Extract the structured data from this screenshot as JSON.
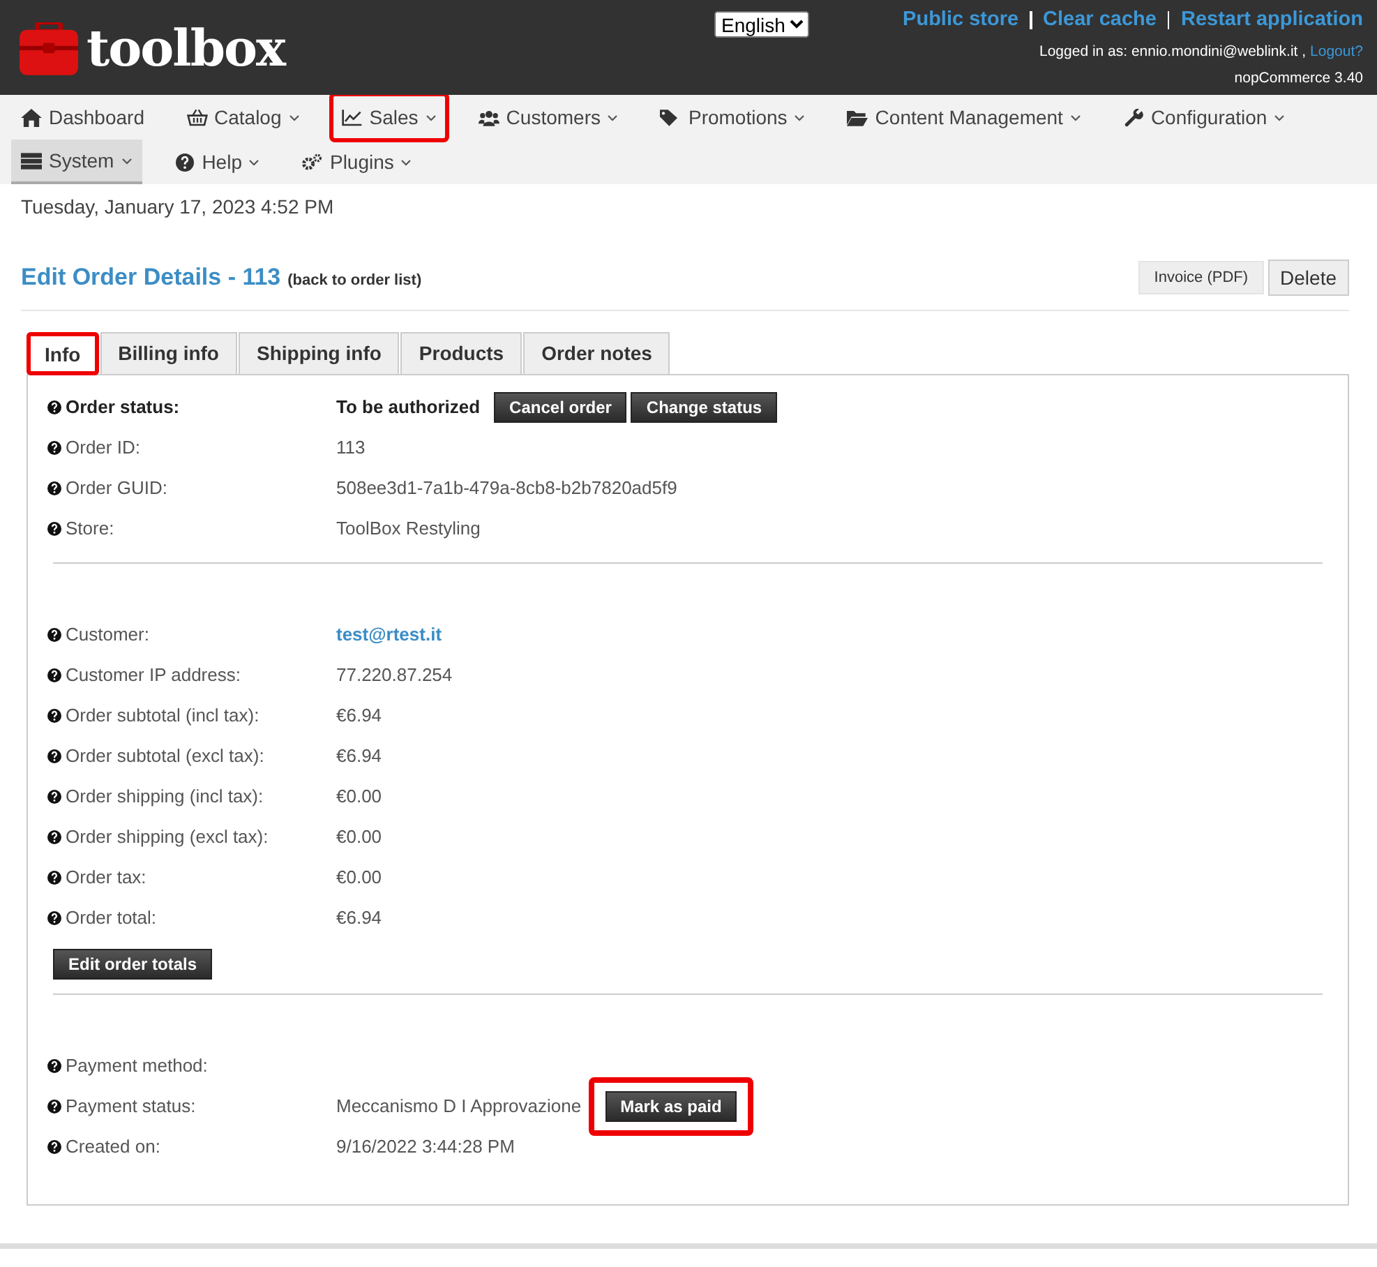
{
  "header": {
    "logo_text": "toolbox",
    "language": "English",
    "links": [
      "Public store",
      "Clear cache",
      "Restart application"
    ],
    "logged_in": "Logged in as: ennio.mondini@weblink.it ,",
    "logout": "Logout?",
    "version": "nopCommerce 3.40"
  },
  "nav": [
    {
      "label": "Dashboard",
      "dropdown": false,
      "selected": false,
      "highlighted": false
    },
    {
      "label": "Catalog",
      "dropdown": true,
      "selected": false,
      "highlighted": false
    },
    {
      "label": "Sales",
      "dropdown": true,
      "selected": false,
      "highlighted": true
    },
    {
      "label": "Customers",
      "dropdown": true,
      "selected": false,
      "highlighted": false
    },
    {
      "label": "Promotions",
      "dropdown": true,
      "selected": false,
      "highlighted": false
    },
    {
      "label": "Content Management",
      "dropdown": true,
      "selected": false,
      "highlighted": false
    },
    {
      "label": "Configuration",
      "dropdown": true,
      "selected": false,
      "highlighted": false
    },
    {
      "label": "System",
      "dropdown": true,
      "selected": true,
      "highlighted": false
    },
    {
      "label": "Help",
      "dropdown": true,
      "selected": false,
      "highlighted": false
    },
    {
      "label": "Plugins",
      "dropdown": true,
      "selected": false,
      "highlighted": false
    }
  ],
  "date": "Tuesday, January 17, 2023 4:52 PM",
  "title": "Edit Order Details - 113",
  "back_link": "(back to order list)",
  "actions": [
    {
      "label": "Invoice (PDF)",
      "kind": "small"
    },
    {
      "label": "Delete",
      "kind": "large"
    }
  ],
  "tabs": [
    {
      "label": "Info",
      "selected": true,
      "highlighted": true
    },
    {
      "label": "Billing info",
      "selected": false,
      "highlighted": false
    },
    {
      "label": "Shipping info",
      "selected": false,
      "highlighted": false
    },
    {
      "label": "Products",
      "selected": false,
      "highlighted": false
    },
    {
      "label": "Order notes",
      "selected": false,
      "highlighted": false
    }
  ],
  "sections": [
    {
      "rows": [
        {
          "label": "Order status:",
          "value": "To be authorized",
          "kind": "status",
          "buttons": [
            {
              "label": "Cancel order",
              "highlighted": false
            },
            {
              "label": "Change status",
              "highlighted": false
            }
          ]
        },
        {
          "label": "Order ID:",
          "value": "113",
          "kind": "text"
        },
        {
          "label": "Order GUID:",
          "value": "508ee3d1-7a1b-479a-8cb8-b2b7820ad5f9",
          "kind": "text"
        },
        {
          "label": "Store:",
          "value": "ToolBox Restyling",
          "kind": "text"
        }
      ]
    },
    {
      "rows": [
        {
          "label": "Customer:",
          "value": "test@rtest.it",
          "kind": "link"
        },
        {
          "label": "Customer IP address:",
          "value": "77.220.87.254",
          "kind": "text"
        },
        {
          "label": "Order subtotal (incl tax):",
          "value": "€6.94",
          "kind": "text"
        },
        {
          "label": "Order subtotal (excl tax):",
          "value": "€6.94",
          "kind": "text"
        },
        {
          "label": "Order shipping (incl tax):",
          "value": "€0.00",
          "kind": "text"
        },
        {
          "label": "Order shipping (excl tax):",
          "value": "€0.00",
          "kind": "text"
        },
        {
          "label": "Order tax:",
          "value": "€0.00",
          "kind": "text"
        },
        {
          "label": "Order total:",
          "value": "€6.94",
          "kind": "text"
        }
      ],
      "footer_button": "Edit order totals"
    },
    {
      "rows": [
        {
          "label": "Payment method:",
          "kind": "text"
        },
        {
          "label": "Payment status:",
          "value": "Meccanismo D I Approvazione",
          "kind": "text",
          "buttons": [
            {
              "label": "Mark as paid",
              "highlighted": true
            }
          ]
        },
        {
          "label": "Created on:",
          "value": "9/16/2022 3:44:28 PM",
          "kind": "text"
        }
      ]
    }
  ]
}
